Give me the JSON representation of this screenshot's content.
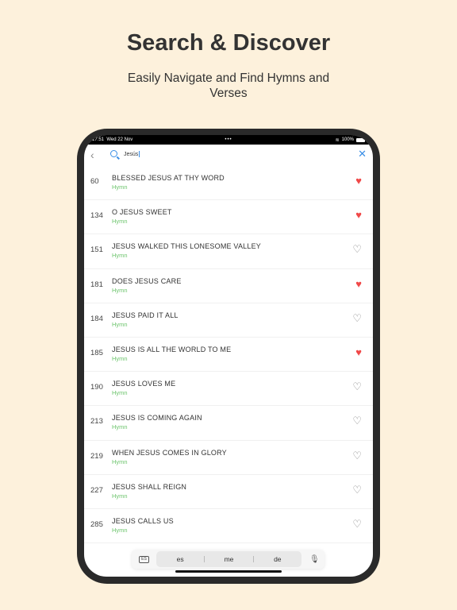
{
  "header": {
    "title": "Search & Discover",
    "subtitle": "Easily Navigate and Find Hymns and Verses"
  },
  "status": {
    "time": "17:51",
    "date": "Wed 22 Nov",
    "dots": "•••",
    "battery": "100%"
  },
  "search": {
    "value": "Jesús"
  },
  "accent": "#3a8ee6",
  "heart_color": "#f04848",
  "type_color": "#6cc46c",
  "hymns": [
    {
      "number": "60",
      "title": "BLESSED JESUS AT THY WORD",
      "type": "Hymn",
      "favorite": true
    },
    {
      "number": "134",
      "title": "O JESUS SWEET",
      "type": "Hymn",
      "favorite": true
    },
    {
      "number": "151",
      "title": "JESUS WALKED THIS LONESOME VALLEY",
      "type": "Hymn",
      "favorite": false
    },
    {
      "number": "181",
      "title": "DOES JESUS CARE",
      "type": "Hymn",
      "favorite": true
    },
    {
      "number": "184",
      "title": "JESUS PAID IT ALL",
      "type": "Hymn",
      "favorite": false
    },
    {
      "number": "185",
      "title": "JESUS IS ALL THE WORLD TO ME",
      "type": "Hymn",
      "favorite": true
    },
    {
      "number": "190",
      "title": "JESUS LOVES ME",
      "type": "Hymn",
      "favorite": false
    },
    {
      "number": "213",
      "title": "JESUS IS COMING AGAIN",
      "type": "Hymn",
      "favorite": false
    },
    {
      "number": "219",
      "title": "WHEN JESUS COMES IN GLORY",
      "type": "Hymn",
      "favorite": false
    },
    {
      "number": "227",
      "title": "JESUS SHALL REIGN",
      "type": "Hymn",
      "favorite": false
    },
    {
      "number": "285",
      "title": "JESUS CALLS US",
      "type": "Hymn",
      "favorite": false
    }
  ],
  "keyboard": {
    "language": "ES",
    "suggestions": [
      "es",
      "me",
      "de"
    ]
  }
}
